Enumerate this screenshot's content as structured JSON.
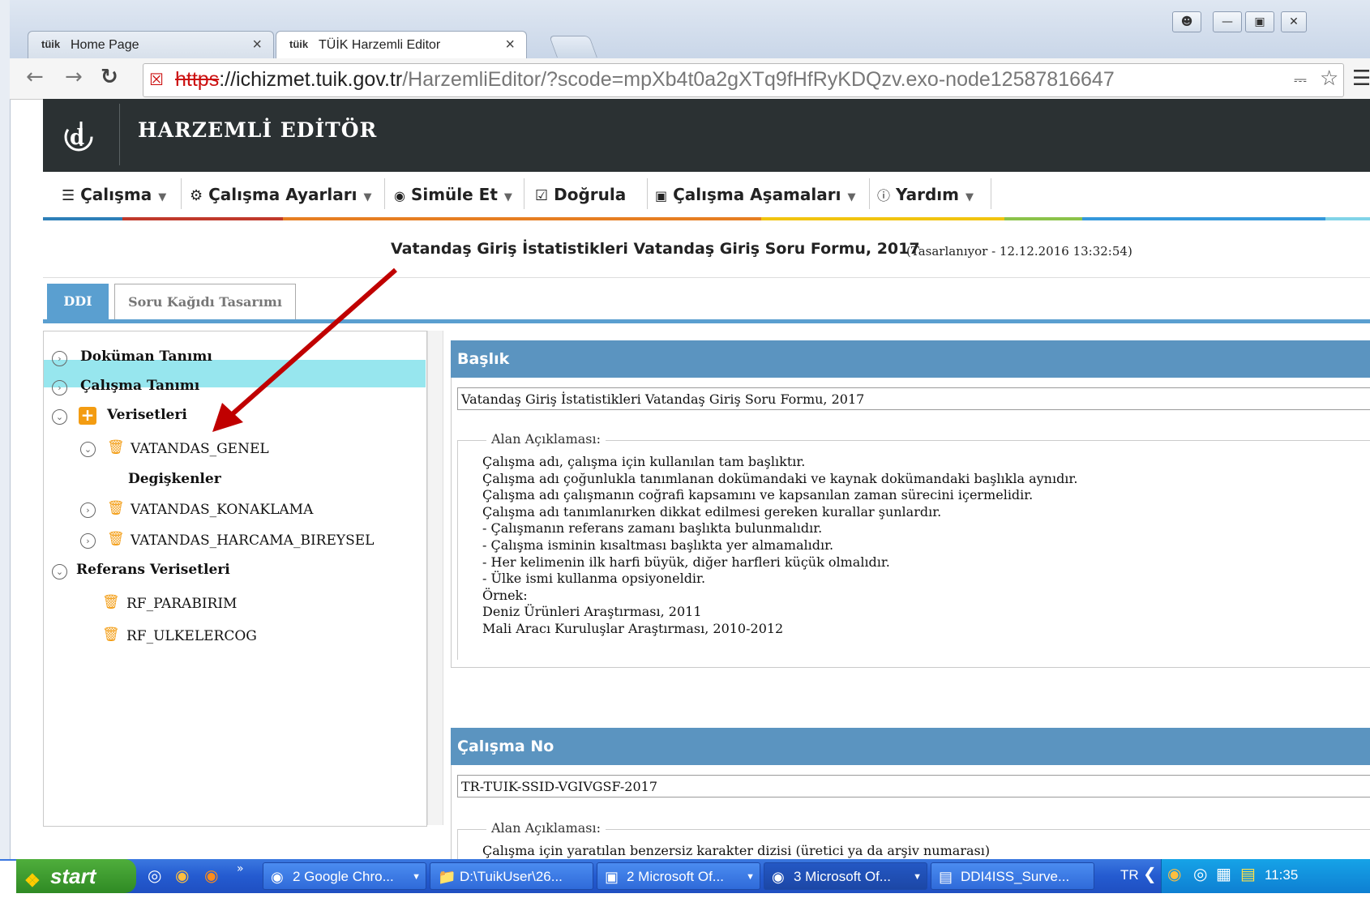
{
  "browser": {
    "tabs": [
      {
        "logo": "tüik",
        "label": "Home Page"
      },
      {
        "logo": "tüik",
        "label": "TÜİK Harzemli Editor"
      }
    ],
    "url_scheme": "https",
    "url_host": "://ichizmet.tuik.gov.tr",
    "url_path": "/HarzemliEditor/?scode=mpXb4t0a2gXTq9fHfRyKDQzv.exo-node12587816647"
  },
  "app": {
    "title": "HARZEMLİ EDİTÖR",
    "menu": [
      {
        "label": "Çalışma",
        "icon": "list-icon",
        "dropdown": true
      },
      {
        "label": "Çalışma Ayarları",
        "icon": "settings-icon",
        "dropdown": true
      },
      {
        "label": "Simüle Et",
        "icon": "eye-icon",
        "dropdown": true
      },
      {
        "label": "Doğrula",
        "icon": "check-icon",
        "dropdown": false
      },
      {
        "label": "Çalışma Aşamaları",
        "icon": "chart-icon",
        "dropdown": true
      },
      {
        "label": "Yardım",
        "icon": "help-icon",
        "dropdown": true
      }
    ],
    "accent_colors": [
      "#2d7fb8",
      "#c0392b",
      "#e67e22",
      "#f1c40f",
      "#8bc34a",
      "#3498db",
      "#81d4e8"
    ]
  },
  "form": {
    "title": "Vatandaş Giriş İstatistikleri Vatandaş Giriş Soru Formu, 2017",
    "status": "(Tasarlanıyor - 12.12.2016 13:32:54)"
  },
  "page_tabs": [
    {
      "label": "DDI",
      "active": true
    },
    {
      "label": "Soru Kağıdı Tasarımı",
      "active": false
    }
  ],
  "tree": {
    "dokuman": "Doküman Tanımı",
    "calisma": "Çalışma Tanımı",
    "verisetleri": "Verisetleri",
    "vatandas_genel": "VATANDAS_GENEL",
    "degiskenler": "Degişkenler",
    "vatandas_konaklama": "VATANDAS_KONAKLAMA",
    "vatandas_harcama": "VATANDAS_HARCAMA_BIREYSEL",
    "referans": "Referans Verisetleri",
    "rf_parabirim": "RF_PARABIRIM",
    "rf_ulkelercog": "RF_ULKELERCOG"
  },
  "baslik": {
    "header": "Başlık",
    "value": "Vatandaş Giriş İstatistikleri Vatandaş Giriş Soru Formu, 2017",
    "legend": "Alan Açıklaması:",
    "lines": [
      "Çalışma adı, çalışma için kullanılan tam başlıktır.",
      "Çalışma adı çoğunlukla tanımlanan dokümandaki ve kaynak dokümandaki başlıkla aynıdır.",
      "Çalışma adı çalışmanın coğrafi kapsamını ve kapsanılan zaman sürecini içermelidir.",
      "",
      "Çalışma adı tanımlanırken dikkat edilmesi gereken kurallar şunlardır.",
      "- Çalışmanın referans zamanı başlıkta bulunmalıdır.",
      "- Çalışma isminin kısaltması başlıkta yer almamalıdır.",
      "- Her kelimenin ilk harfi büyük, diğer harfleri küçük olmalıdır.",
      "- Ülke ismi kullanma opsiyoneldir.",
      "",
      "Örnek:",
      "Deniz Ürünleri Araştırması, 2011",
      "Mali Aracı Kuruluşlar Araştırması, 2010-2012"
    ]
  },
  "calisma_no": {
    "header": "Çalışma No",
    "value": "TR-TUIK-SSID-VGIVGSF-2017",
    "legend": "Alan Açıklaması:",
    "line1": "Çalışma için yaratılan benzersiz karakter dizisi (üretici ya da arşiv numarası)"
  },
  "taskbar": {
    "start": "start",
    "items": [
      "2 Google Chro...",
      "D:\\TuikUser\\26...",
      "2 Microsoft Of...",
      "3 Microsoft Of...",
      "DDI4ISS_Surve..."
    ],
    "lang": "TR",
    "clock": "11:35"
  }
}
